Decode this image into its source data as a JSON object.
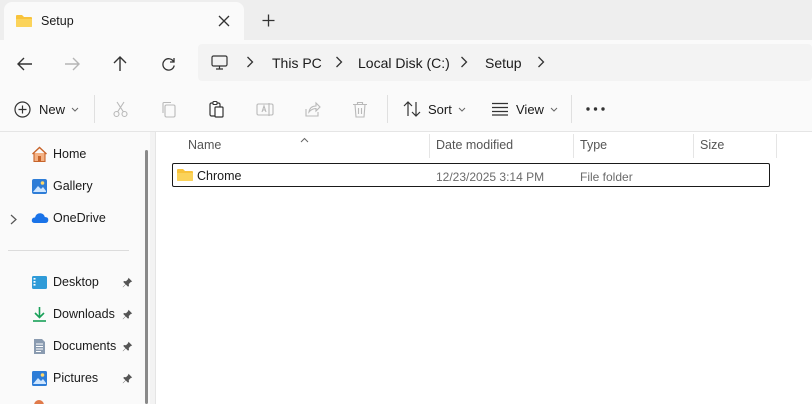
{
  "tab": {
    "title": "Setup"
  },
  "address": {
    "crumbs": [
      "This PC",
      "Local Disk (C:)",
      "Setup"
    ]
  },
  "toolbar": {
    "new_label": "New",
    "sort_label": "Sort",
    "view_label": "View"
  },
  "sidebar": {
    "items": [
      {
        "label": "Home"
      },
      {
        "label": "Gallery"
      },
      {
        "label": "OneDrive"
      }
    ],
    "quick": [
      {
        "label": "Desktop"
      },
      {
        "label": "Downloads"
      },
      {
        "label": "Documents"
      },
      {
        "label": "Pictures"
      }
    ]
  },
  "columns": {
    "name": "Name",
    "date": "Date modified",
    "type": "Type",
    "size": "Size"
  },
  "files": [
    {
      "name": "Chrome",
      "date": "12/23/2025 3:14 PM",
      "type": "File folder",
      "size": ""
    }
  ],
  "colors": {
    "folder": "#f8c33b",
    "accent": "#0067c0"
  }
}
